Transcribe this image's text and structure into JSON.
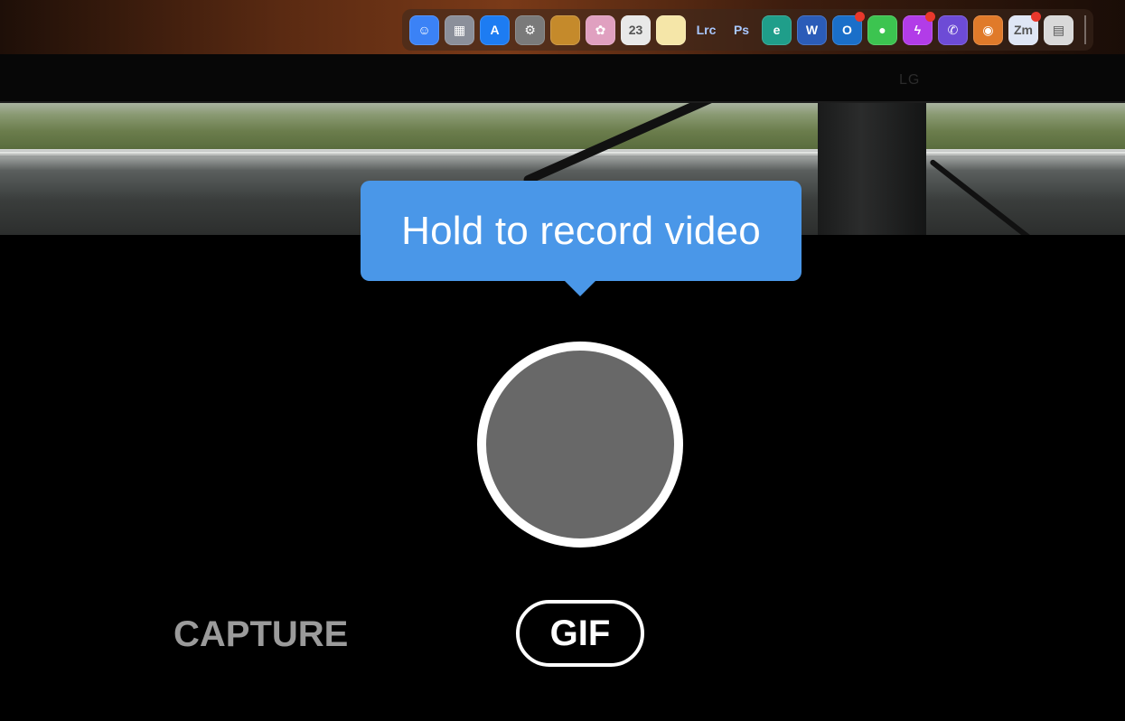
{
  "viewfinder": {
    "monitor_logo": "LG",
    "dock": {
      "icons": [
        {
          "name": "finder-icon",
          "color": "#3b82f6",
          "glyph": "☺"
        },
        {
          "name": "launchpad-icon",
          "color": "#8b8f9a",
          "glyph": "▦"
        },
        {
          "name": "app-store-icon",
          "color": "#1d7cf2",
          "glyph": "A"
        },
        {
          "name": "system-settings-icon",
          "color": "#7a7a7a",
          "glyph": "⚙"
        },
        {
          "name": "notes-folder-icon",
          "color": "#c58a2b",
          "glyph": ""
        },
        {
          "name": "photos-icon",
          "color": "#e0a0c0",
          "glyph": "✿"
        },
        {
          "name": "calendar-icon",
          "color": "#e8e8e8",
          "glyph": "23"
        },
        {
          "name": "notes-icon",
          "color": "#f5e6a8",
          "glyph": ""
        },
        {
          "name": "lightroom-classic-icon",
          "color": "transparent",
          "glyph": "Lrc"
        },
        {
          "name": "photoshop-icon",
          "color": "transparent",
          "glyph": "Ps"
        },
        {
          "name": "edge-icon",
          "color": "#1f9e8a",
          "glyph": "e"
        },
        {
          "name": "word-icon",
          "color": "#2b5cb8",
          "glyph": "W"
        },
        {
          "name": "outlook-icon",
          "color": "#1a6fc9",
          "glyph": "O",
          "badge": true
        },
        {
          "name": "messages-icon",
          "color": "#3cc450",
          "glyph": "●"
        },
        {
          "name": "messenger-icon",
          "color": "#b23ce8",
          "glyph": "ϟ",
          "badge": true
        },
        {
          "name": "viber-icon",
          "color": "#6d4bd6",
          "glyph": "✆"
        },
        {
          "name": "transmit-icon",
          "color": "#e07a2a",
          "glyph": "◉"
        },
        {
          "name": "zoom-icon",
          "color": "#dfe6f5",
          "glyph": "Zm",
          "badge": true
        },
        {
          "name": "preview-icon",
          "color": "#d9d9d9",
          "glyph": "▤"
        }
      ]
    }
  },
  "tooltip": {
    "text": "Hold to record video"
  },
  "modes": {
    "capture_label": "CAPTURE",
    "gif_label": "GIF",
    "selected": "GIF"
  }
}
